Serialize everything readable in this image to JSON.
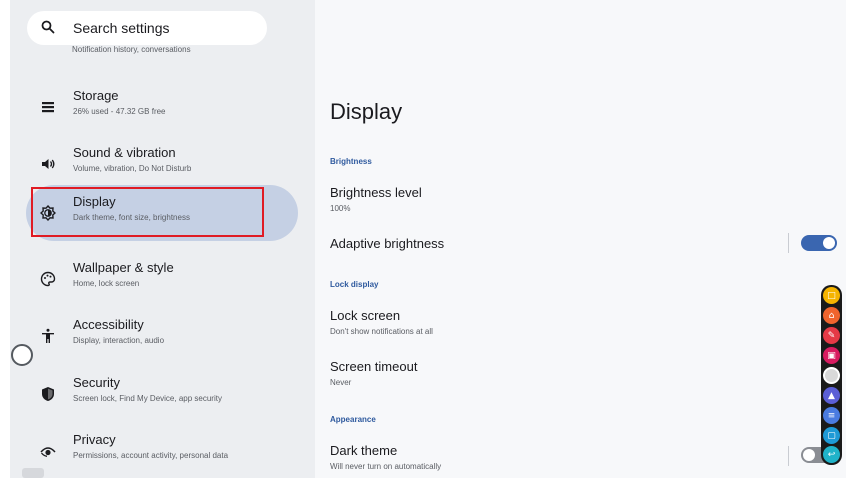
{
  "search": {
    "placeholder": "Search settings",
    "icon": "search-icon"
  },
  "sidebar": {
    "cut_off_subtitle": "Notification history, conversations",
    "items": [
      {
        "title": "Storage",
        "subtitle": "26% used - 47.32 GB free",
        "icon": "storage-icon",
        "active": false
      },
      {
        "title": "Sound & vibration",
        "subtitle": "Volume, vibration, Do Not Disturb",
        "icon": "volume-icon",
        "active": false
      },
      {
        "title": "Display",
        "subtitle": "Dark theme, font size, brightness",
        "icon": "brightness-icon",
        "active": true
      },
      {
        "title": "Wallpaper & style",
        "subtitle": "Home, lock screen",
        "icon": "palette-icon",
        "active": false
      },
      {
        "title": "Accessibility",
        "subtitle": "Display, interaction, audio",
        "icon": "accessibility-icon",
        "active": false
      },
      {
        "title": "Security",
        "subtitle": "Screen lock, Find My Device, app security",
        "icon": "shield-icon",
        "active": false
      },
      {
        "title": "Privacy",
        "subtitle": "Permissions, account activity, personal data",
        "icon": "eye-icon",
        "active": false
      }
    ]
  },
  "main": {
    "title": "Display",
    "sections": {
      "brightness": "Brightness",
      "lock_display": "Lock display",
      "appearance": "Appearance"
    },
    "rows": {
      "brightness_level": {
        "title": "Brightness level",
        "subtitle": "100%"
      },
      "adaptive_brightness": {
        "title": "Adaptive brightness",
        "toggle": true
      },
      "lock_screen": {
        "title": "Lock screen",
        "subtitle": "Don't show notifications at all"
      },
      "screen_timeout": {
        "title": "Screen timeout",
        "subtitle": "Never"
      },
      "dark_theme": {
        "title": "Dark theme",
        "subtitle": "Will never turn on automatically",
        "toggle": false
      }
    }
  },
  "colors": {
    "accent": "#3a66b0",
    "active_nav": "#c5d0e4",
    "highlight_box": "#e01b24",
    "sidebar_bg": "#eceef1"
  },
  "floating_dock": {
    "buttons": [
      {
        "icon": "chat-icon",
        "color": "#f5b400"
      },
      {
        "icon": "home-icon",
        "color": "#f0642d"
      },
      {
        "icon": "edit-icon",
        "color": "#e53946"
      },
      {
        "icon": "screen-icon",
        "color": "#d81b60"
      },
      {
        "icon": "record-icon",
        "color": "#d9d9d9"
      },
      {
        "icon": "eraser-icon",
        "color": "#5b5fd6"
      },
      {
        "icon": "list-icon",
        "color": "#4a7be0"
      },
      {
        "icon": "window-icon",
        "color": "#1e9ad6"
      },
      {
        "icon": "back-icon",
        "color": "#20b3c9"
      }
    ]
  }
}
